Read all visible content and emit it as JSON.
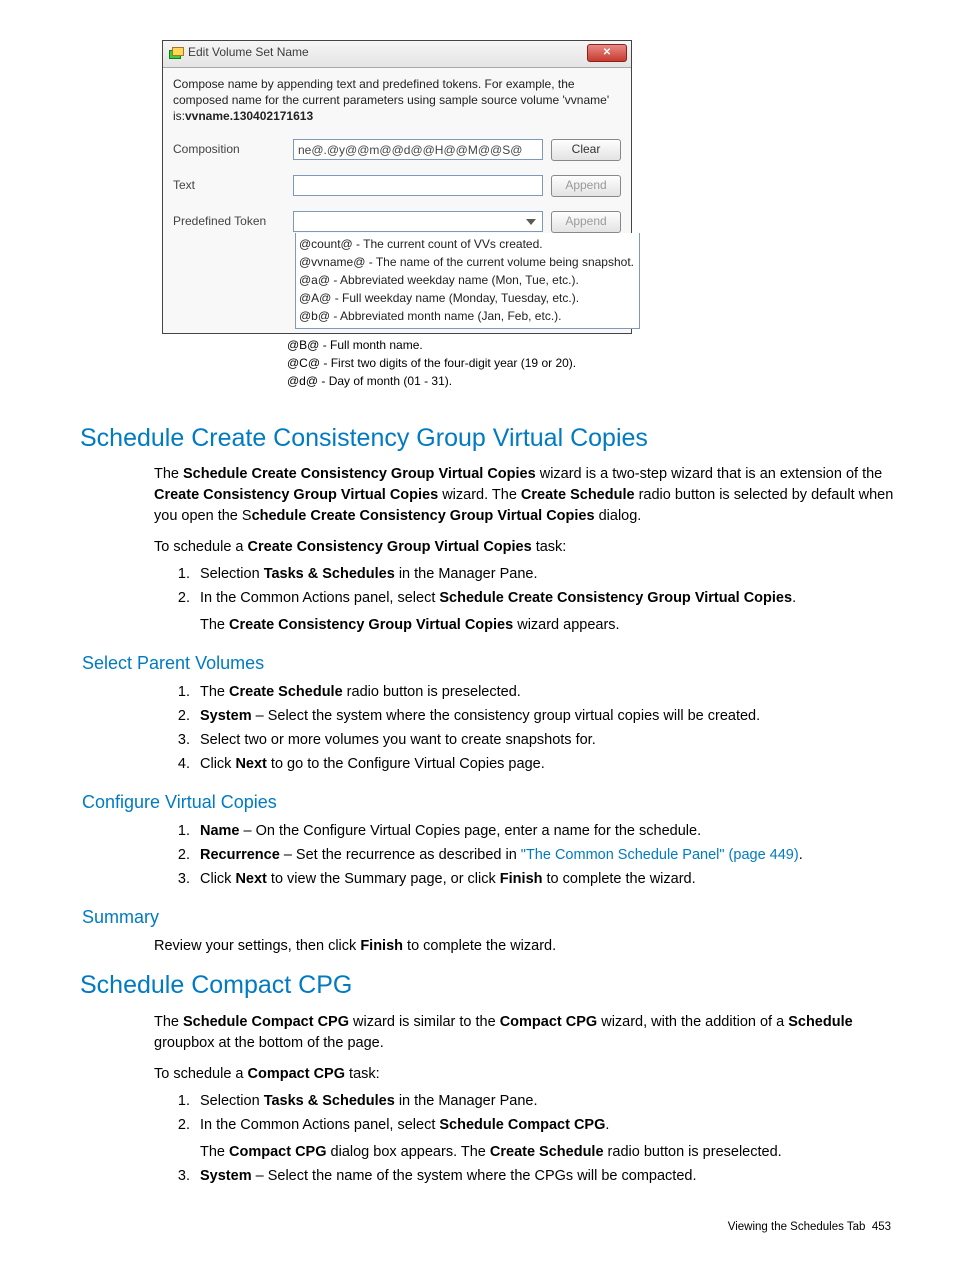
{
  "dialog": {
    "title": "Edit Volume Set Name",
    "desc_pre": "Compose name by appending text and predefined tokens. For example, the composed name for the current parameters using sample source volume 'vvname' is:",
    "desc_bold": "vvname.130402171613",
    "rows": {
      "composition": {
        "label": "Composition",
        "value": "ne@.@y@@m@@d@@H@@M@@S@",
        "btn": "Clear"
      },
      "text": {
        "label": "Text",
        "value": "",
        "btn": "Append"
      },
      "token": {
        "label": "Predefined Token",
        "btn": "Append"
      }
    },
    "tokens_boxed": [
      "@count@ - The current count of VVs created.",
      "@vvname@ - The name of the current volume being snapshot.",
      "@a@ - Abbreviated weekday name (Mon, Tue, etc.).",
      "@A@ - Full weekday name (Monday, Tuesday, etc.).",
      "@b@ - Abbreviated month name (Jan, Feb, etc.)."
    ],
    "tokens_open": [
      "@B@ - Full month name.",
      "@C@ - First two digits of the four-digit year (19 or 20).",
      "@d@ - Day of month (01 - 31)."
    ]
  },
  "h_main1": "Schedule Create Consistency Group Virtual Copies",
  "p1": {
    "a": "The ",
    "b1": "Schedule Create Consistency Group Virtual Copies",
    "c": " wizard is a two-step wizard that is an extension of the ",
    "b2": "Create Consistency Group Virtual Copies",
    "d": " wizard. The ",
    "b3": "Create Schedule",
    "e": " radio button is selected by default when you open the S",
    "b4": "chedule Create Consistency Group Virtual Copies",
    "f": " dialog."
  },
  "p2": {
    "a": "To schedule a ",
    "b": "Create Consistency Group Virtual Copies",
    "c": " task:"
  },
  "list1": {
    "i1": {
      "a": "Selection ",
      "b": "Tasks & Schedules",
      "c": " in the Manager Pane."
    },
    "i2": {
      "a": "In the Common Actions panel, select ",
      "b": "Schedule Create Consistency Group Virtual Copies",
      "c": ".",
      "sub_a": "The ",
      "sub_b": "Create Consistency Group Virtual Copies",
      "sub_c": " wizard appears."
    }
  },
  "h_sub1": "Select Parent Volumes",
  "list2": {
    "i1": {
      "a": "The ",
      "b": "Create Schedule",
      "c": " radio button is preselected."
    },
    "i2": {
      "b": "System",
      "c": " – Select the system where the consistency group virtual copies will be created."
    },
    "i3": {
      "a": "Select two or more volumes you want to create snapshots for."
    },
    "i4": {
      "a": "Click ",
      "b": "Next",
      "c": " to go to the Configure Virtual Copies page."
    }
  },
  "h_sub2": "Configure Virtual Copies",
  "list3": {
    "i1": {
      "b": "Name",
      "c": " – On the Configure Virtual Copies page, enter a name for the schedule."
    },
    "i2": {
      "b": "Recurrence",
      "c": " – Set the recurrence as described in ",
      "link": "\"The Common Schedule Panel\" (page 449)",
      "d": "."
    },
    "i3": {
      "a": "Click ",
      "b": "Next",
      "c": " to view the Summary page, or click ",
      "b2": "Finish",
      "d": " to complete the wizard."
    }
  },
  "h_sub3": "Summary",
  "p_summary": {
    "a": "Review your settings, then click ",
    "b": "Finish",
    "c": " to complete the wizard."
  },
  "h_main2": "Schedule Compact CPG",
  "p3": {
    "a": "The ",
    "b1": "Schedule Compact CPG",
    "c": " wizard is similar to the ",
    "b2": "Compact CPG",
    "d": " wizard, with the addition of a ",
    "b3": "Schedule",
    "e": " groupbox at the bottom of the page."
  },
  "p4": {
    "a": "To schedule a ",
    "b": "Compact CPG",
    "c": " task:"
  },
  "list4": {
    "i1": {
      "a": "Selection ",
      "b": "Tasks & Schedules",
      "c": " in the Manager Pane."
    },
    "i2": {
      "a": "In the Common Actions panel, select ",
      "b": "Schedule Compact CPG",
      "c": ".",
      "sub_a": "The ",
      "sub_b": "Compact CPG",
      "sub_c": " dialog box appears. The ",
      "sub_b2": "Create Schedule",
      "sub_d": " radio button is preselected."
    },
    "i3": {
      "b": "System",
      "c": " – Select the name of the system where the CPGs will be compacted."
    }
  },
  "footer": {
    "text": "Viewing the Schedules Tab",
    "page": "453"
  }
}
